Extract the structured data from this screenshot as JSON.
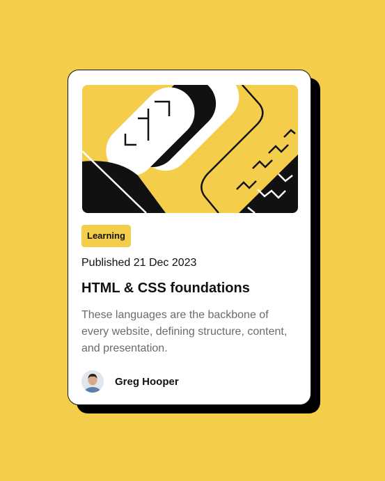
{
  "card": {
    "tag": "Learning",
    "published": "Published 21 Dec 2023",
    "title": "HTML & CSS foundations",
    "description": "These languages are the backbone of every website, defining structure, content, and presentation.",
    "author": {
      "name": "Greg Hooper"
    }
  },
  "colors": {
    "background": "#F4CE4B",
    "accent": "#F4CE4B",
    "text": "#111111",
    "muted": "#6B6B6B",
    "shadow": "#000000"
  },
  "icons": [
    "hero-illustration",
    "author-avatar"
  ]
}
